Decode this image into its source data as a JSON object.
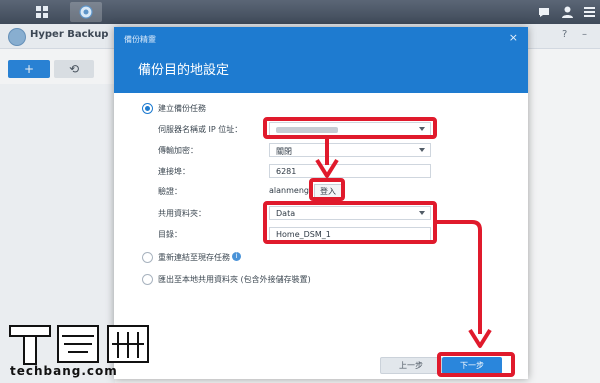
{
  "taskbar": {
    "icons": [
      "apps-grid-icon",
      "hyper-backup-icon"
    ],
    "right_icons": [
      "chat-icon",
      "user-icon",
      "menu-icon"
    ]
  },
  "app": {
    "title": "Hyper Backup",
    "controls": [
      "?",
      "–"
    ]
  },
  "dialog": {
    "window_title": "備份精靈",
    "close": "×",
    "title": "備份目的地設定",
    "option_create": "建立備份任務",
    "server_label": "伺服器名稱或 IP 位址：",
    "transfer_label": "傳輸加密：",
    "transfer_value": "關閉",
    "port_label": "連接埠：",
    "port_value": "6281",
    "auth_label": "驗證：",
    "auth_value": "alanmeng",
    "login_button": "登入",
    "shared_label": "共用資料夾：",
    "shared_value": "Data",
    "dir_label": "目錄：",
    "dir_value": "Home_DSM_1",
    "option_relink": "重新連結至現存任務",
    "option_export": "匯出至本地共用資料夾 (包含外接儲存裝置)",
    "prev_button": "上一步",
    "next_button": "下一步"
  },
  "watermark": {
    "text": "techbang.com"
  },
  "colors": {
    "accent": "#1e7bd0",
    "highlight": "#e01a2c"
  }
}
